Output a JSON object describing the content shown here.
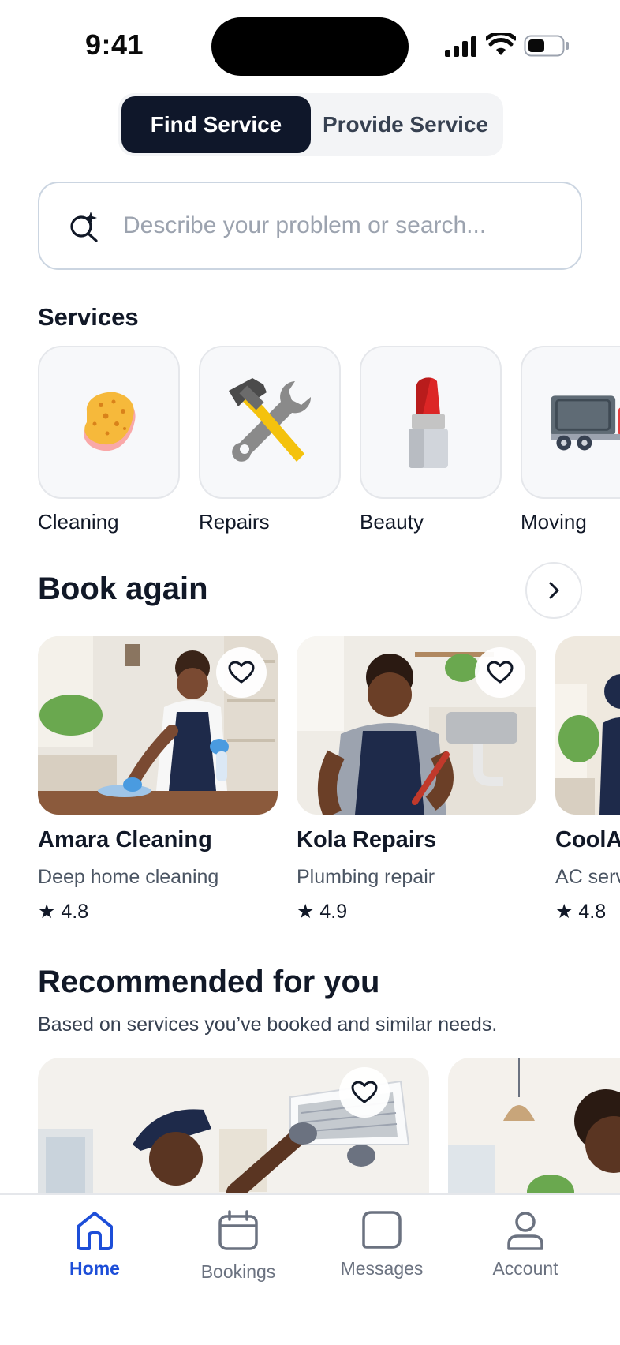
{
  "status_bar": {
    "time": "9:41"
  },
  "segmented": {
    "find_label": "Find Service",
    "provide_label": "Provide Service",
    "selected": "Find Service"
  },
  "search": {
    "placeholder": "Describe your problem or search...",
    "value": ""
  },
  "services": {
    "title": "Services",
    "items": [
      {
        "label": "Cleaning",
        "icon": "sponge-icon"
      },
      {
        "label": "Repairs",
        "icon": "hammer-wrench-icon"
      },
      {
        "label": "Beauty",
        "icon": "lipstick-icon"
      },
      {
        "label": "Moving",
        "icon": "truck-icon"
      }
    ]
  },
  "book_again": {
    "title": "Book again",
    "items": [
      {
        "name": "Amara Cleaning",
        "service": "Deep home cleaning",
        "rating": "★ 4.8"
      },
      {
        "name": "Kola Repairs",
        "service": "Plumbing repair",
        "rating": "★ 4.9"
      },
      {
        "name": "CoolA",
        "service": "AC serv",
        "rating": "★ 4.8"
      }
    ]
  },
  "recommended": {
    "title": "Recommended for you",
    "subtitle": "Based on services you’ve booked and similar needs."
  },
  "tabbar": {
    "items": [
      {
        "label": "Home",
        "icon": "home-icon",
        "active": true
      },
      {
        "label": "Bookings",
        "icon": "calendar-icon",
        "active": false
      },
      {
        "label": "Messages",
        "icon": "message-icon",
        "active": false
      },
      {
        "label": "Account",
        "icon": "user-icon",
        "active": false
      }
    ]
  },
  "colors": {
    "accent": "#1d4ed8",
    "dark": "#0f172a",
    "muted": "#6b7280"
  }
}
